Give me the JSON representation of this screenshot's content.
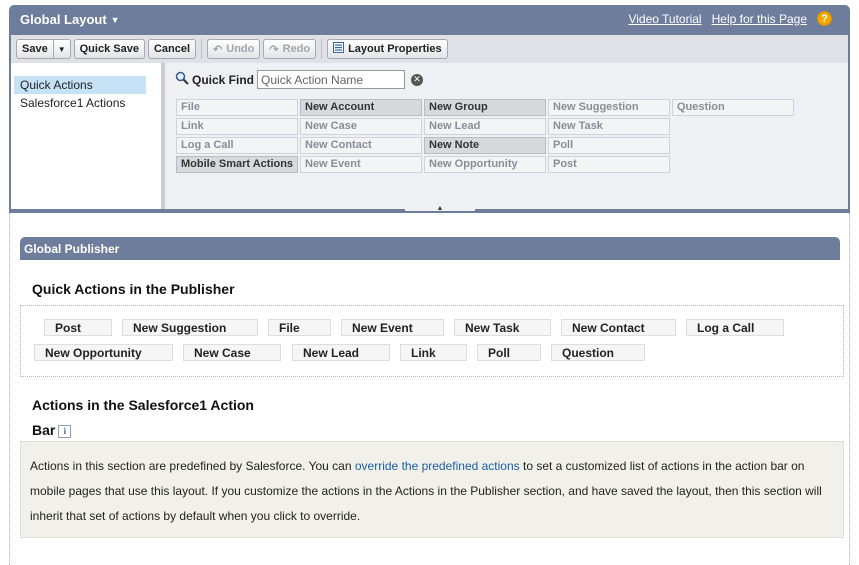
{
  "header": {
    "title": "Global Layout",
    "video_tutorial": "Video Tutorial",
    "help_link": "Help for this Page",
    "help_icon": "?"
  },
  "toolbar": {
    "save": "Save",
    "quick_save": "Quick Save",
    "cancel": "Cancel",
    "undo": "Undo",
    "redo": "Redo",
    "layout_properties": "Layout Properties"
  },
  "left_nav": {
    "items": [
      {
        "label": "Quick Actions",
        "active": true
      },
      {
        "label": "Salesforce1 Actions",
        "active": false
      }
    ]
  },
  "quick_find": {
    "label": "Quick Find",
    "placeholder": "Quick Action Name"
  },
  "palette": {
    "rows": [
      [
        "File",
        "New Account",
        "New Group",
        "New Suggestion",
        "Question"
      ],
      [
        "Link",
        "New Case",
        "New Lead",
        "New Task",
        ""
      ],
      [
        "Log a Call",
        "New Contact",
        "New Note",
        "Poll",
        ""
      ],
      [
        "Mobile Smart Actions",
        "New Event",
        "New Opportunity",
        "Post",
        ""
      ]
    ],
    "used_items": [
      "New Account",
      "New Group",
      "New Note",
      "Mobile Smart Actions"
    ]
  },
  "section": {
    "title": "Global Publisher"
  },
  "quick_actions_publisher": {
    "title": "Quick Actions in the Publisher",
    "actions": [
      "Post",
      "New Suggestion",
      "File",
      "New Event",
      "New Task",
      "New Contact",
      "Log a Call",
      "New Opportunity",
      "New Case",
      "New Lead",
      "Link",
      "Poll",
      "Question"
    ]
  },
  "sf1_bar": {
    "title_line1": "Actions in the Salesforce1 Action",
    "title_line2": "Bar",
    "info_icon": "i"
  },
  "info": {
    "text_before_link": "Actions in this section are predefined by Salesforce. You can ",
    "link": "override the predefined actions",
    "text_after_link": " to set a customized list of actions in the action bar on mobile pages that use this layout. If you customize the actions in the Actions in the Publisher section, and have saved the layout, then this section will inherit that set of actions by default when you click to override."
  },
  "colors": {
    "header": "#6f7d9d",
    "toolbar": "#dfe1e6",
    "nav_active": "#c5e2f7",
    "link": "#1a5ea6",
    "info_bg": "#f1f1ea",
    "help_icon": "#f3a600"
  },
  "icons": {
    "save_dropdown": "chevron-down-icon",
    "undo": "undo-icon",
    "redo": "redo-icon",
    "layout_properties": "properties-icon",
    "quick_find": "search-icon",
    "clear": "clear-icon",
    "help": "help-icon",
    "info": "info-icon",
    "drag_handle": "collapse-handle-icon"
  }
}
